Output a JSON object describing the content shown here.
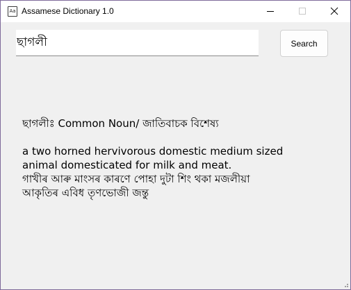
{
  "window": {
    "title": "Assamese Dictionary 1.0",
    "icon_text": "Aa",
    "controls": {
      "minimize_icon": "minimize-icon",
      "maximize_icon": "maximize-icon",
      "close_icon": "close-icon"
    }
  },
  "search": {
    "value": "ছাগলী",
    "button_label": "Search"
  },
  "result": {
    "heading": "ছাগলীঃ Common Noun/ জাতিবাচক বিশেষ্য",
    "definition_en": [
      "a two horned hervivorous domestic medium sized",
      "animal domesticated for milk and meat."
    ],
    "definition_as": [
      "গাখীৰ আৰু মাংসৰ কাৰণে পোহা দুটা শিং থকা মজলীয়া",
      "আকৃতিৰ এবিধ তৃণভোজী জন্তু"
    ]
  },
  "colors": {
    "window_bg": "#f0f0f0",
    "titlebar_bg": "#ffffff",
    "border": "#7e6a9a"
  }
}
